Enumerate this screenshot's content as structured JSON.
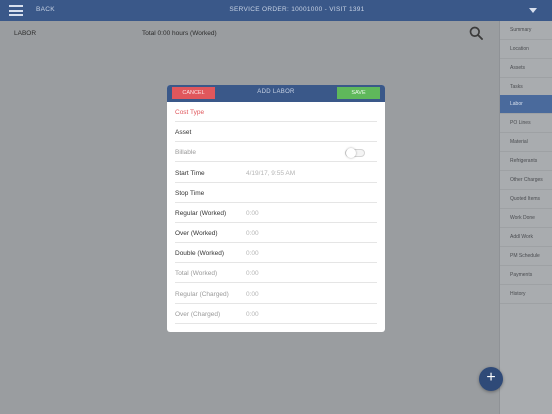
{
  "header": {
    "back_label": "BACK",
    "title": "SERVICE ORDER: 10001000 - VISIT 1391"
  },
  "subheader": {
    "section": "LABOR",
    "total": "Total 0:00 hours (Worked)"
  },
  "sidebar": {
    "items": [
      {
        "label": "Summary"
      },
      {
        "label": "Location"
      },
      {
        "label": "Assets"
      },
      {
        "label": "Tasks"
      },
      {
        "label": "Labor",
        "active": true
      },
      {
        "label": "PO Lines"
      },
      {
        "label": "Material"
      },
      {
        "label": "Refrigerants"
      },
      {
        "label": "Other Charges"
      },
      {
        "label": "Quoted Items"
      },
      {
        "label": "Work Done"
      },
      {
        "label": "Addl Work"
      },
      {
        "label": "PM Schedule"
      },
      {
        "label": "Payments"
      },
      {
        "label": "History"
      }
    ]
  },
  "modal": {
    "title": "ADD LABOR",
    "cancel_label": "CANCEL",
    "save_label": "SAVE",
    "fields": [
      {
        "label": "Cost Type",
        "value": "",
        "style": "required"
      },
      {
        "label": "Asset",
        "value": "",
        "style": "normal"
      },
      {
        "label": "Billable",
        "value": "",
        "style": "dim",
        "toggle": "off"
      },
      {
        "label": "Start Time",
        "value": "4/19/17, 9:55 AM",
        "style": "normal"
      },
      {
        "label": "Stop Time",
        "value": "",
        "style": "normal"
      },
      {
        "label": "Regular (Worked)",
        "value": "0:00",
        "style": "normal"
      },
      {
        "label": "Over (Worked)",
        "value": "0:00",
        "style": "normal"
      },
      {
        "label": "Double (Worked)",
        "value": "0:00",
        "style": "normal"
      },
      {
        "label": "Total (Worked)",
        "value": "0:00",
        "style": "dim"
      },
      {
        "label": "Regular (Charged)",
        "value": "0:00",
        "style": "dim"
      },
      {
        "label": "Over (Charged)",
        "value": "0:00",
        "style": "dim"
      }
    ]
  },
  "fab": {
    "label": "+"
  },
  "colors": {
    "header": "#3a5889",
    "cancel": "#e0575c",
    "save": "#5fb85b",
    "active_tab": "#4a6a9c"
  },
  "icons": {
    "menu": "hamburger-icon",
    "search": "search-icon",
    "dropdown": "caret-down-icon",
    "add": "plus-icon"
  }
}
